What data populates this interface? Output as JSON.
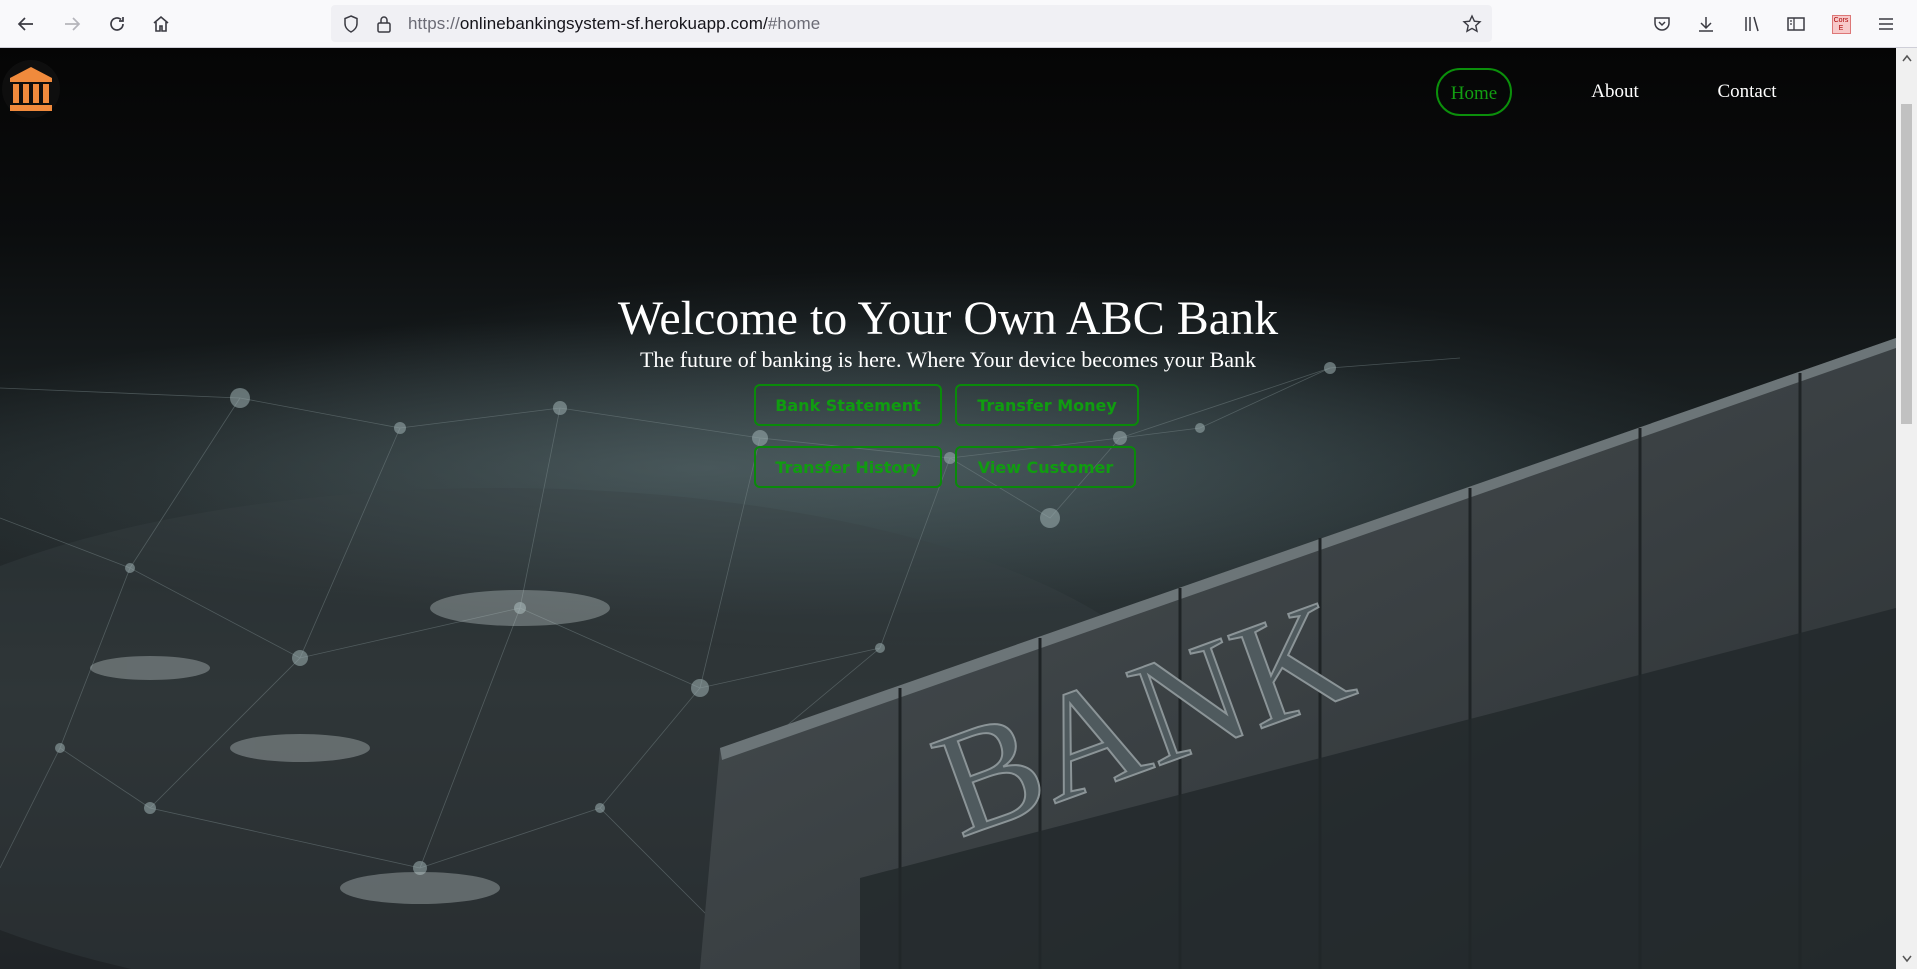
{
  "browser": {
    "url_scheme": "https://",
    "url_host": "onlinebankingsystem-sf.herokuapp.com/",
    "url_hash": "#home",
    "extension_badge": "Cors E"
  },
  "nav": {
    "home": "Home",
    "about": "About",
    "contact": "Contact"
  },
  "hero": {
    "title": "Welcome to Your Own ABC Bank",
    "subtitle": "The future of banking is here. Where Your device becomes your Bank"
  },
  "actions": {
    "bank_statement": "Bank Statement",
    "transfer_money": "Transfer Money",
    "transfer_history": "Transfer History",
    "view_customer": "View Customer"
  },
  "background": {
    "building_sign": "BANK"
  },
  "colors": {
    "accent_green": "#0a8a0a",
    "logo_orange": "#f08a3c",
    "page_bg": "#0b0d0e"
  },
  "icons": [
    "back-arrow-icon",
    "forward-arrow-icon",
    "reload-icon",
    "home-icon",
    "shield-icon",
    "lock-icon",
    "star-icon",
    "pocket-icon",
    "download-icon",
    "library-icon",
    "sidebar-icon",
    "menu-icon",
    "bank-logo-icon"
  ]
}
